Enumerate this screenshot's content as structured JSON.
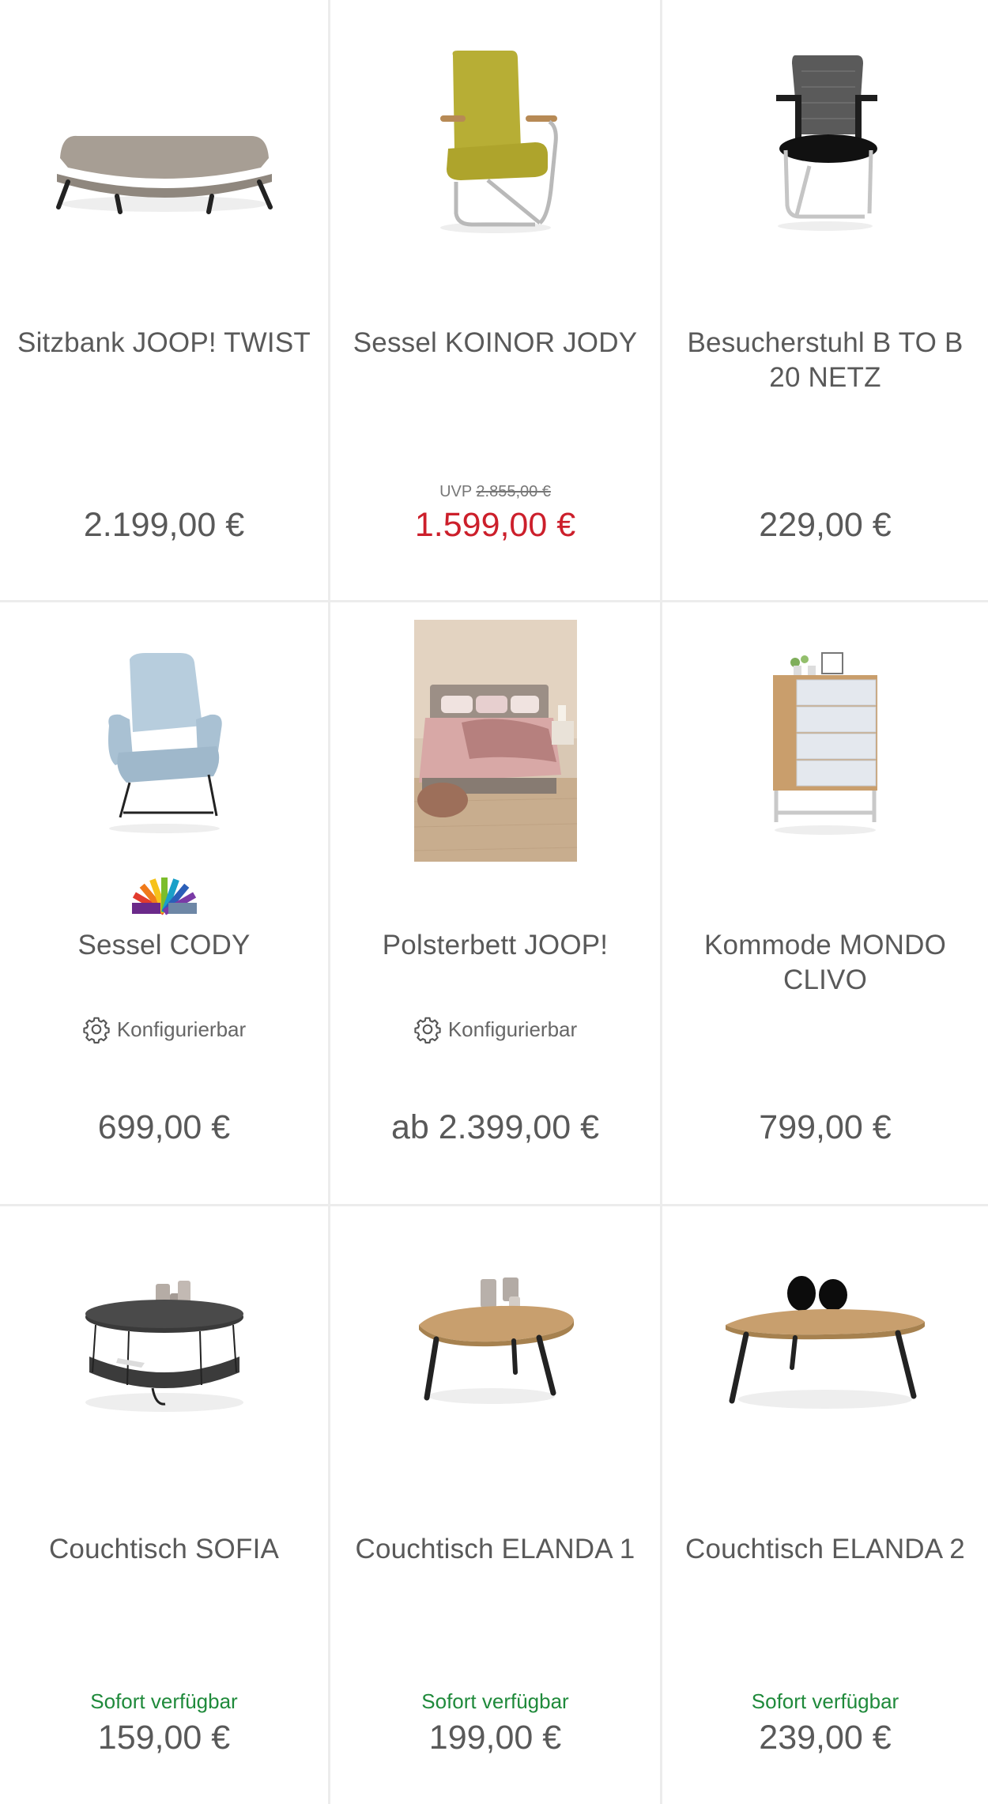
{
  "products": [
    {
      "title": "Sitzbank JOOP! TWIST",
      "price": "2.199,00 €"
    },
    {
      "title": "Sessel KOINOR JODY",
      "uvp_label": "UVP",
      "uvp_price": "2.855,00 €",
      "price": "1.599,00 €"
    },
    {
      "title": "Besucherstuhl B TO B 20 NETZ",
      "price": "229,00 €"
    },
    {
      "title": "Sessel CODY",
      "config_label": "Konfigurierbar",
      "price": "699,00 €"
    },
    {
      "title": "Polsterbett JOOP!",
      "config_label": "Konfigurierbar",
      "price": "ab 2.399,00 €"
    },
    {
      "title": "Kommode MONDO CLIVO",
      "price": "799,00 €"
    },
    {
      "title": "Couchtisch SOFIA",
      "availability": "Sofort verfügbar",
      "price": "159,00 €"
    },
    {
      "title": "Couchtisch ELANDA 1",
      "availability": "Sofort verfügbar",
      "price": "199,00 €"
    },
    {
      "title": "Couchtisch ELANDA 2",
      "availability": "Sofort verfügbar",
      "price": "239,00 €"
    }
  ],
  "colors": {
    "price": "#595959",
    "sale_price": "#cc1f2b",
    "availability": "#1f8a3b",
    "grid_line": "#ececec"
  },
  "icons": {
    "config": "gear-icon",
    "colors": "color-palette-icon"
  }
}
